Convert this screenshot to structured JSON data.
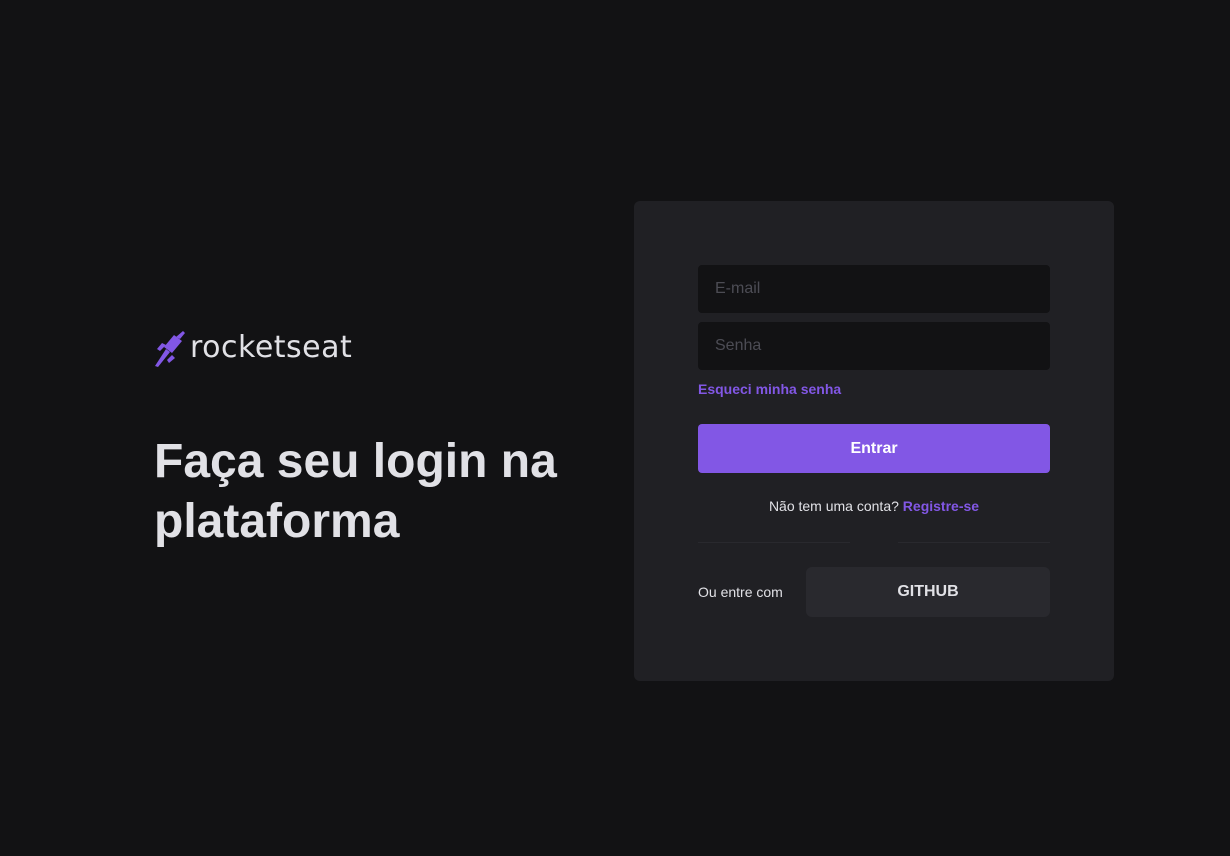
{
  "brand": {
    "name": "rocketseat",
    "icon": "rocket-icon",
    "accent": "#8257e5"
  },
  "hero": {
    "headline": "Faça seu login na plataforma"
  },
  "form": {
    "email_placeholder": "E-mail",
    "email_value": "",
    "password_placeholder": "Senha",
    "password_value": "",
    "forgot_label": "Esqueci minha senha",
    "submit_label": "Entrar",
    "signup_prompt": "Não tem uma conta?",
    "signup_link": "Registre-se",
    "alt_login_label": "Ou entre com",
    "github_label": "GITHUB"
  },
  "colors": {
    "background": "#121214",
    "card": "#202024",
    "accent": "#8257e5",
    "text": "#e1e1e6",
    "secondary_button": "#29292e"
  }
}
